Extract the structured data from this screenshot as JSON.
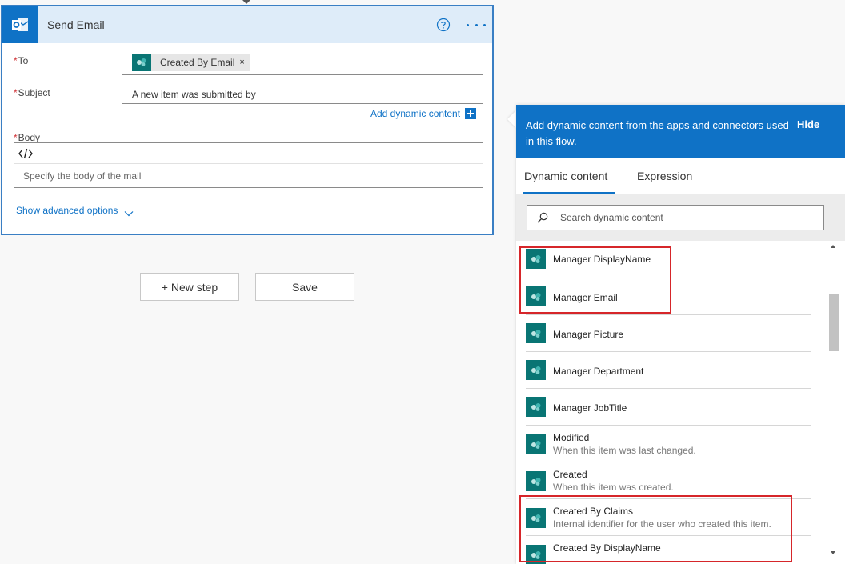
{
  "action": {
    "title": "Send Email",
    "icon": "outlook-icon",
    "fields": {
      "to": {
        "label": "To",
        "required_mark": "*",
        "token": {
          "label": "Created By Email",
          "remove": "×",
          "icon": "sharepoint-icon"
        }
      },
      "subject": {
        "label": "Subject",
        "required_mark": "*",
        "value": "A new item was submitted by"
      },
      "body": {
        "label": "Body",
        "required_mark": "*",
        "placeholder": "Specify the body of the mail"
      }
    },
    "add_dynamic_content": "Add dynamic content",
    "show_advanced": "Show advanced options"
  },
  "buttons": {
    "new_step": "+ New step",
    "save": "Save"
  },
  "panel": {
    "header": "Add dynamic content from the apps and connectors used in this flow.",
    "hide": "Hide",
    "tabs": [
      "Dynamic content",
      "Expression"
    ],
    "active_tab": "Dynamic content",
    "search_placeholder": "Search dynamic content",
    "items": [
      {
        "title": "Manager DisplayName",
        "desc": ""
      },
      {
        "title": "Manager Email",
        "desc": ""
      },
      {
        "title": "Manager Picture",
        "desc": ""
      },
      {
        "title": "Manager Department",
        "desc": ""
      },
      {
        "title": "Manager JobTitle",
        "desc": ""
      },
      {
        "title": "Modified",
        "desc": "When this item was last changed."
      },
      {
        "title": "Created",
        "desc": "When this item was created."
      },
      {
        "title": "Created By Claims",
        "desc": "Internal identifier for the user who created this item."
      },
      {
        "title": "Created By DisplayName",
        "desc": ""
      }
    ]
  },
  "colors": {
    "accent": "#0f72c6",
    "sharepoint": "#097574",
    "highlight": "#d6262a",
    "required": "#d13438"
  }
}
